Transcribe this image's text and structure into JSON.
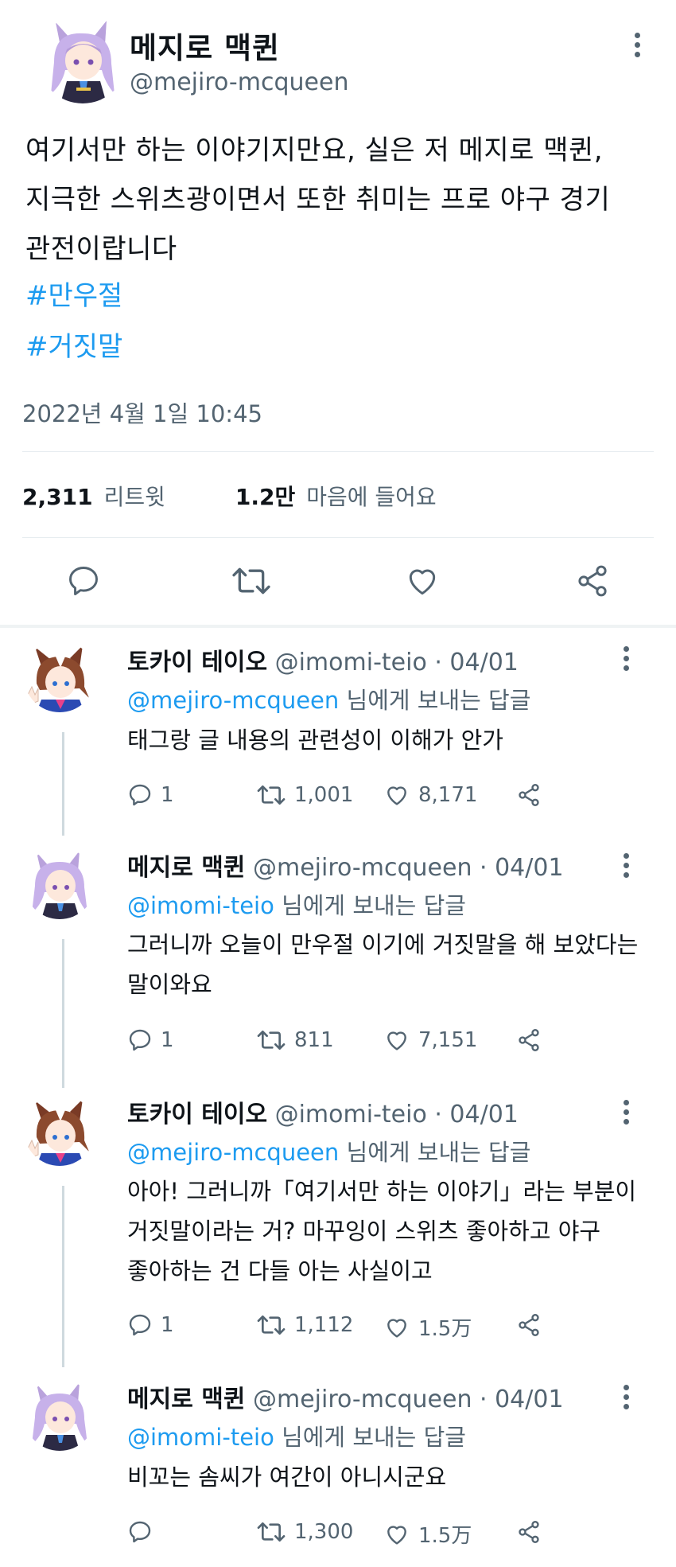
{
  "main_tweet": {
    "author_name": "메지로 맥퀸",
    "author_handle": "@mejiro-mcqueen",
    "text_lines": [
      "여기서만 하는 이야기지만요, 실은 저 메지로 맥퀸,",
      "지극한 스위츠광이면서 또한 취미는 프로 야구 경기",
      "관전이랍니다"
    ],
    "hashtags": [
      "#만우절",
      "#거짓말"
    ],
    "timestamp": "2022년 4월 1일 10:45",
    "retweets_count": "2,311",
    "retweets_label": "리트윗",
    "likes_count": "1.2만",
    "likes_label": "마음에 들어요"
  },
  "replies": [
    {
      "author_name": "토카이 테이오",
      "meta": "@imomi-teio · 04/01",
      "reply_to_handle": "@mejiro-mcqueen",
      "reply_to_suffix": "님에게 보내는 답글",
      "text_lines": [
        "태그랑 글 내용의 관련성이 이해가 안가"
      ],
      "replies": "1",
      "retweets": "1,001",
      "likes": "8,171"
    },
    {
      "author_name": "메지로 맥퀸",
      "meta": "@mejiro-mcqueen · 04/01",
      "reply_to_handle": "@imomi-teio",
      "reply_to_suffix": "님에게 보내는 답글",
      "text_lines": [
        "그러니까 오늘이 만우절 이기에 거짓말을 해 보았다는",
        "말이와요"
      ],
      "replies": "1",
      "retweets": "811",
      "likes": "7,151"
    },
    {
      "author_name": "토카이 테이오",
      "meta": "@imomi-teio · 04/01",
      "reply_to_handle": "@mejiro-mcqueen",
      "reply_to_suffix": "님에게 보내는 답글",
      "text_lines": [
        "아아! 그러니까「여기서만 하는 이야기」라는 부분이",
        "거짓말이라는 거? 마꾸잉이 스위츠 좋아하고 야구",
        "좋아하는 건 다들 아는 사실이고"
      ],
      "replies": "1",
      "retweets": "1,112",
      "likes": "1.5万"
    },
    {
      "author_name": "메지로 맥퀸",
      "meta": "@mejiro-mcqueen · 04/01",
      "reply_to_handle": "@imomi-teio",
      "reply_to_suffix": "님에게 보내는 답글",
      "text_lines": [
        "비꼬는 솜씨가 여간이 아니시군요"
      ],
      "replies": "",
      "retweets": "1,300",
      "likes": "1.5万"
    }
  ],
  "colors": {
    "link": "#1d9bf0",
    "secondary_text": "#536471",
    "primary_text": "#0f1419",
    "divider": "#e6ecf0"
  }
}
